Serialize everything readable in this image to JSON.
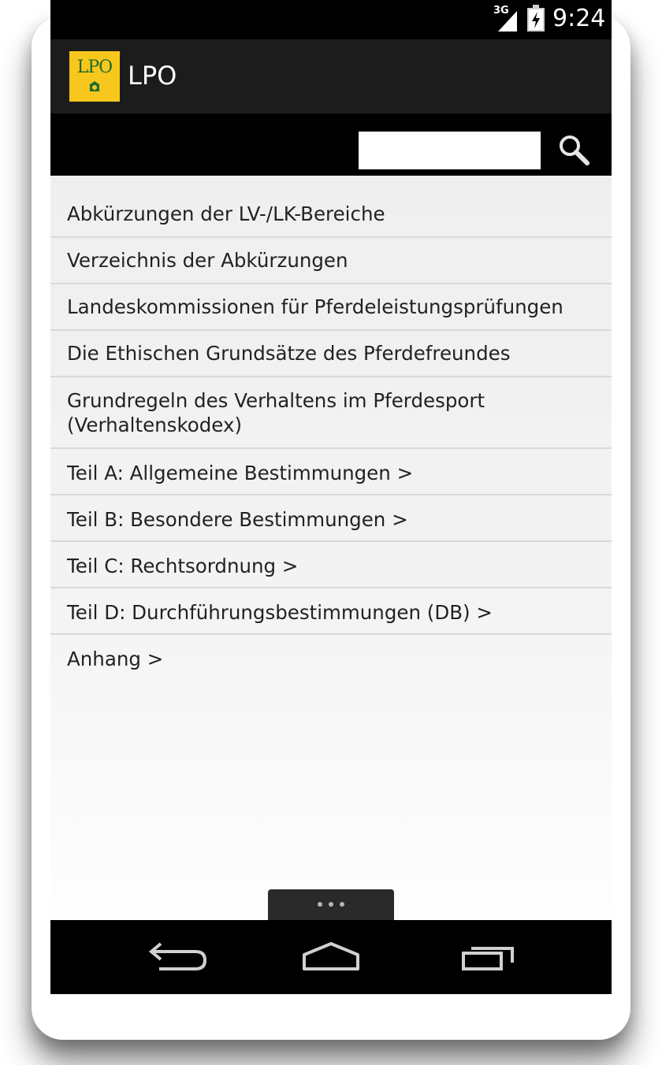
{
  "status_bar": {
    "network": "3G",
    "time": "9:24",
    "signal_icon": "signal-icon",
    "battery_icon": "battery-charging-icon"
  },
  "app_bar": {
    "logo_text": "LPO",
    "title": "LPO",
    "logo_color": "#f7c71e"
  },
  "search": {
    "placeholder": "",
    "value": "",
    "button_icon": "search-icon"
  },
  "menu_items": [
    "Abkürzungen der LV-/LK-Bereiche",
    "Verzeichnis der Abkürzungen",
    "Landeskommissionen für Pferdeleistungsprüfungen",
    "Die Ethischen Grundsätze des Pferdefreundes",
    "Grundregeln des Verhaltens im Pferdesport (Verhaltenskodex)",
    "Teil A: Allgemeine Bestimmungen >",
    "Teil B: Besondere Bestimmungen >",
    "Teil C: Rechtsordnung >",
    "Teil D: Durchführungsbestimmungen (DB) >",
    "Anhang >"
  ],
  "overflow_menu": {
    "icon": "overflow-dots-icon"
  },
  "nav_bar": {
    "back_icon": "back-icon",
    "home_icon": "home-icon",
    "recents_icon": "recents-icon"
  }
}
